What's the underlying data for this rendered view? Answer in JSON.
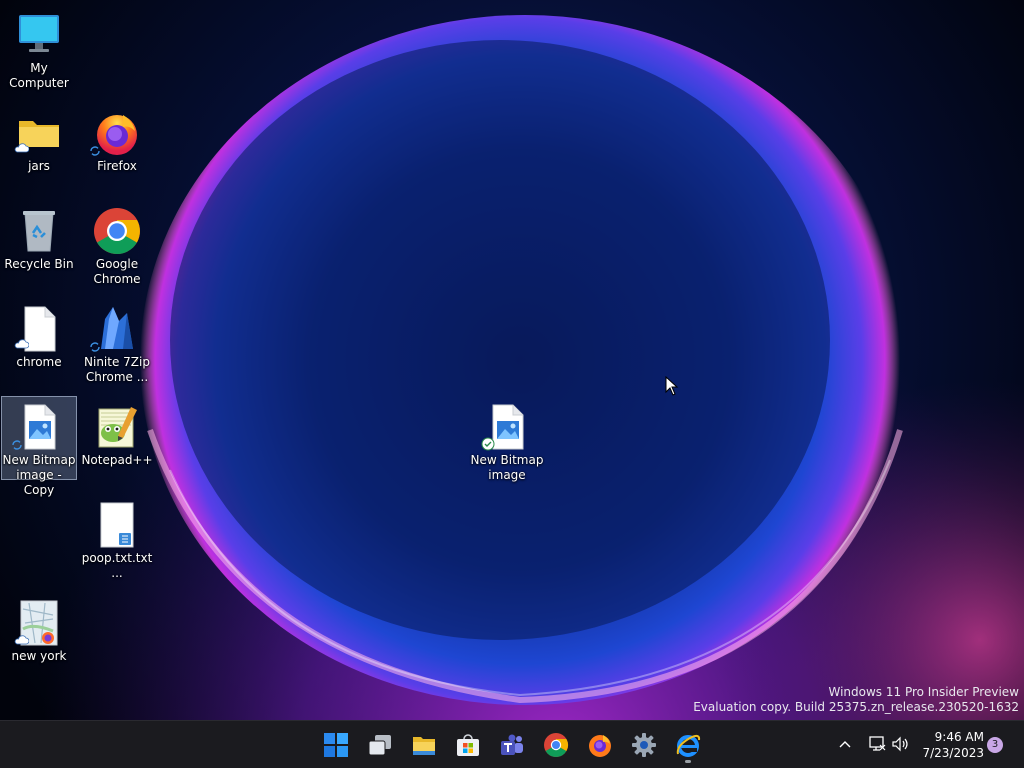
{
  "desktop": {
    "icons": [
      {
        "label": "My Computer",
        "glyph": "monitor-icon"
      },
      {
        "label": "jars",
        "glyph": "folder-icon"
      },
      {
        "label": "Firefox",
        "glyph": "firefox-icon"
      },
      {
        "label": "Recycle Bin",
        "glyph": "recycle-bin-icon"
      },
      {
        "label": "Google Chrome",
        "glyph": "chrome-icon"
      },
      {
        "label": "chrome",
        "glyph": "blank-file-icon"
      },
      {
        "label": "Ninite 7Zip Chrome ...",
        "glyph": "ninite-icon"
      },
      {
        "label": "New Bitmap image - Copy",
        "glyph": "bitmap-file-icon"
      },
      {
        "label": "Notepad++",
        "glyph": "notepad-plus-plus-icon"
      },
      {
        "label": "poop.txt.txt...",
        "glyph": "text-file-icon"
      },
      {
        "label": "new york",
        "glyph": "map-file-icon"
      },
      {
        "label": "New Bitmap image",
        "glyph": "bitmap-file-icon"
      }
    ]
  },
  "watermark": {
    "line1": "Windows 11 Pro Insider Preview",
    "line2": "Evaluation copy. Build 25375.zn_release.230520-1632"
  },
  "taskbar": {
    "apps": [
      "start-icon",
      "task-view-icon",
      "file-explorer-icon",
      "microsoft-store-icon",
      "teams-icon",
      "chrome-icon",
      "firefox-icon",
      "settings-icon",
      "internet-explorer-icon"
    ],
    "tray_icons": [
      "chevron-up-icon",
      "network-icon",
      "volume-icon"
    ],
    "time": "9:46 AM",
    "date": "7/23/2023",
    "notification_count": "3"
  },
  "colors": {
    "taskbar": "#1b1b1f",
    "selection": "#b4c8e6",
    "bloom_blue": "#1e46d2",
    "bloom_magenta": "#c030e0"
  }
}
